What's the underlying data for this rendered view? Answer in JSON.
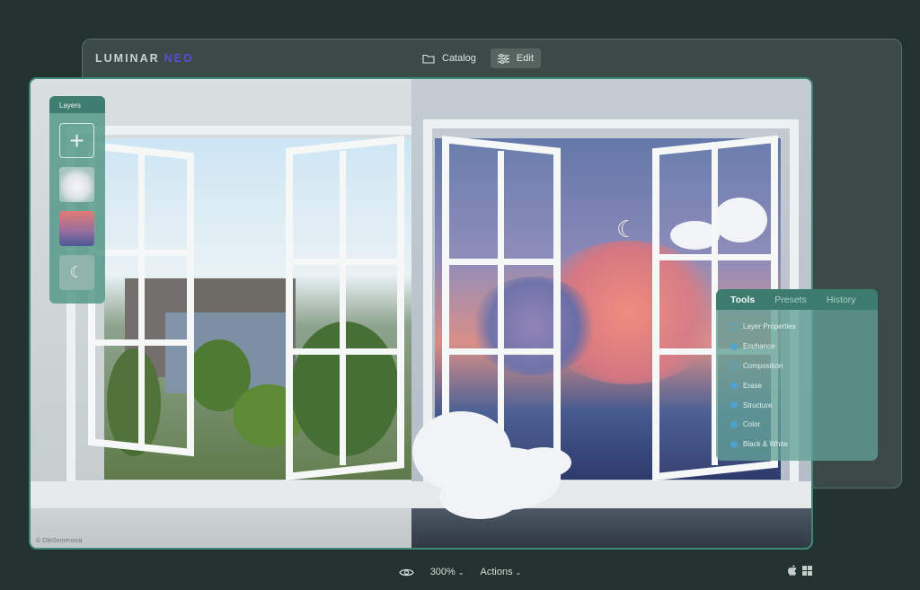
{
  "app": {
    "logo_main": "LUMINAR",
    "logo_accent": "NEO"
  },
  "topnav": {
    "catalog_label": "Catalog",
    "edit_label": "Edit"
  },
  "layers": {
    "title": "Layers",
    "add_symbol": "+"
  },
  "tools_panel": {
    "tabs": [
      "Tools",
      "Presets",
      "History"
    ],
    "active_tab": "Tools",
    "items": [
      "Layer Properties",
      "Enchance",
      "Composition",
      "Erase",
      "Structure",
      "Color",
      "Black & White"
    ]
  },
  "photo": {
    "credit": "© OleSemenova"
  },
  "bottom": {
    "zoom": "300%",
    "actions_label": "Actions"
  },
  "colors": {
    "accent": "#3d8778",
    "logo_accent": "#5b4bd6",
    "panel": "#3d7b6f"
  },
  "icons": {
    "catalog": "folder-icon",
    "edit": "sliders-icon",
    "view": "eye-icon",
    "apple": "apple-icon",
    "windows": "windows-icon"
  }
}
